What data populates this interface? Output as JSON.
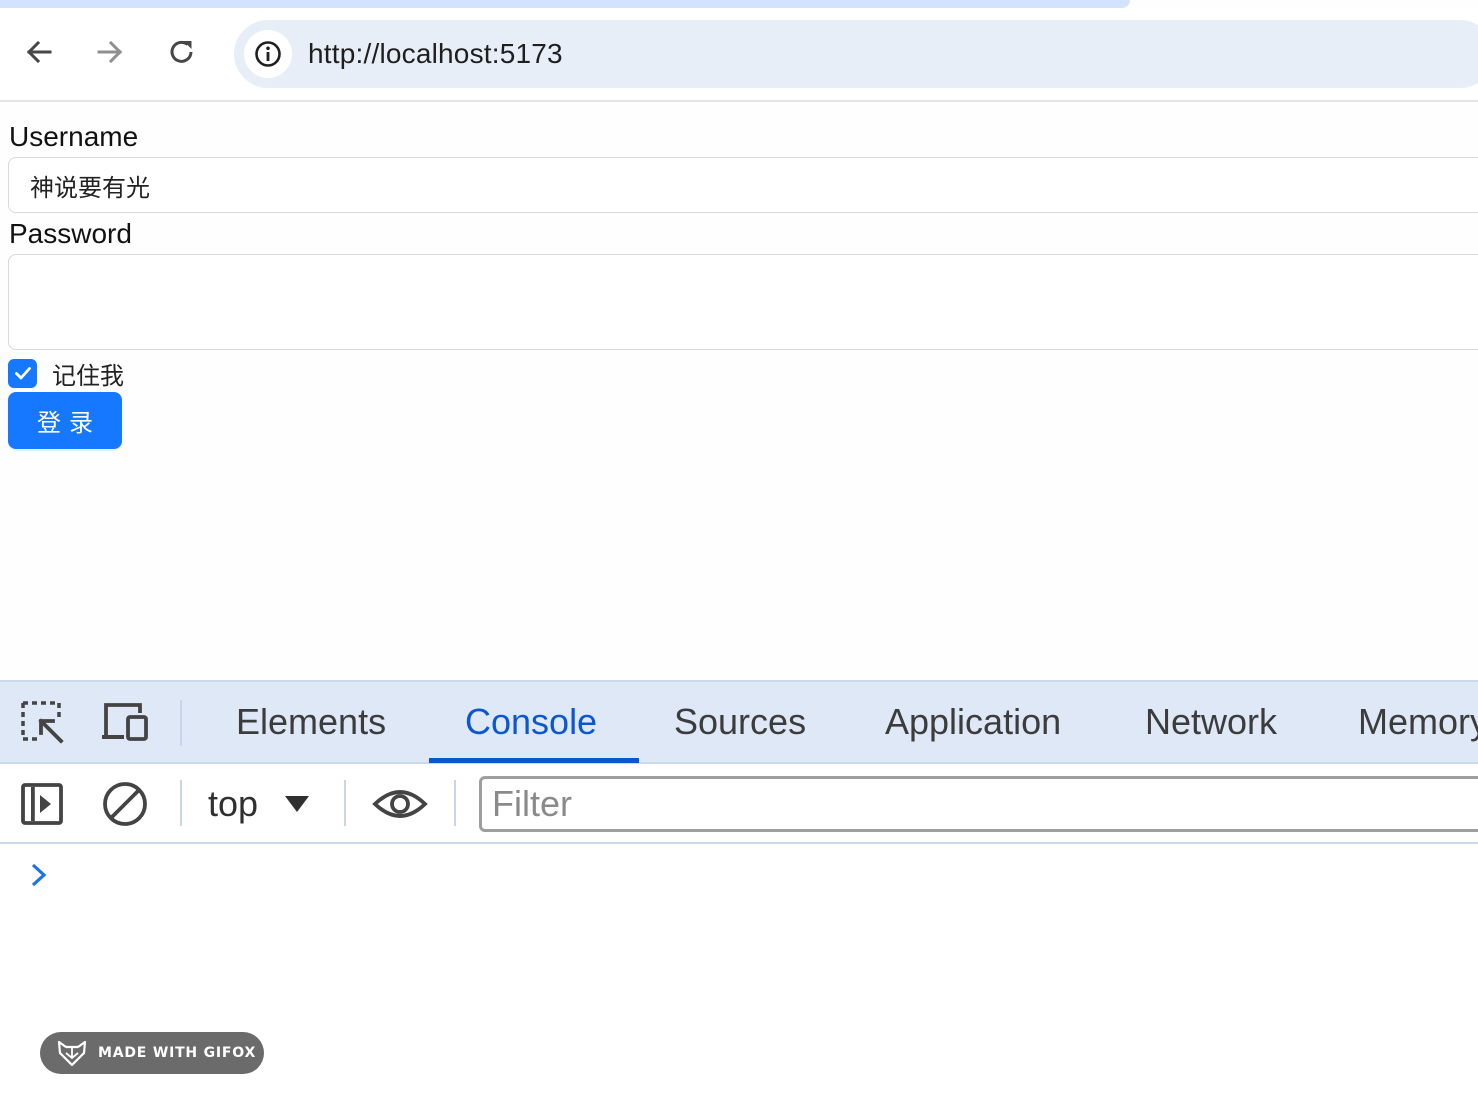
{
  "browser": {
    "url": "http://localhost:5173",
    "icons": {
      "back": "arrow-left-icon",
      "forward": "arrow-right-icon",
      "reload": "reload-icon",
      "site_info": "info-icon"
    }
  },
  "form": {
    "username_label": "Username",
    "username_value": "神说要有光",
    "password_label": "Password",
    "password_value": "",
    "remember_label": "记住我",
    "remember_checked": true,
    "login_label": "登录"
  },
  "devtools": {
    "tabs": [
      {
        "label": "Elements",
        "active": false
      },
      {
        "label": "Console",
        "active": true
      },
      {
        "label": "Sources",
        "active": false
      },
      {
        "label": "Application",
        "active": false
      },
      {
        "label": "Network",
        "active": false
      },
      {
        "label": "Memory",
        "active": false
      }
    ],
    "context": "top",
    "filter_placeholder": "Filter"
  },
  "watermark": {
    "text": "MADE WITH GIFOX"
  },
  "colors": {
    "primary": "#1677ff",
    "devtools_accent": "#0b57d0",
    "devtools_tabbar": "#dfe8f6",
    "omnibox": "#e8eef8"
  }
}
